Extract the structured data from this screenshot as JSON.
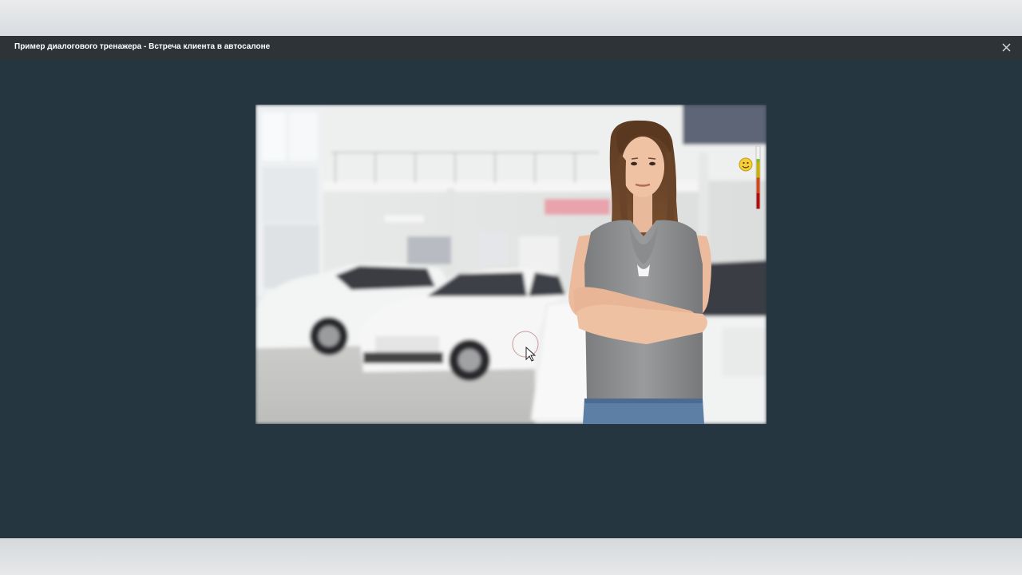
{
  "modal": {
    "title": "Пример диалогового тренажера - Встреча клиента в автосалоне"
  },
  "icons": {
    "close": "close-icon",
    "mood": "smiley-face-icon",
    "cursor": "mouse-cursor-icon"
  },
  "mood_meter": {
    "level": 0.3,
    "colors": [
      "#7dbb2a",
      "#c9b100",
      "#d2461c",
      "#b10d0d"
    ]
  },
  "colors": {
    "modal_bg": "#253640",
    "header_bg": "#2e3338",
    "header_text": "#ffffff"
  }
}
